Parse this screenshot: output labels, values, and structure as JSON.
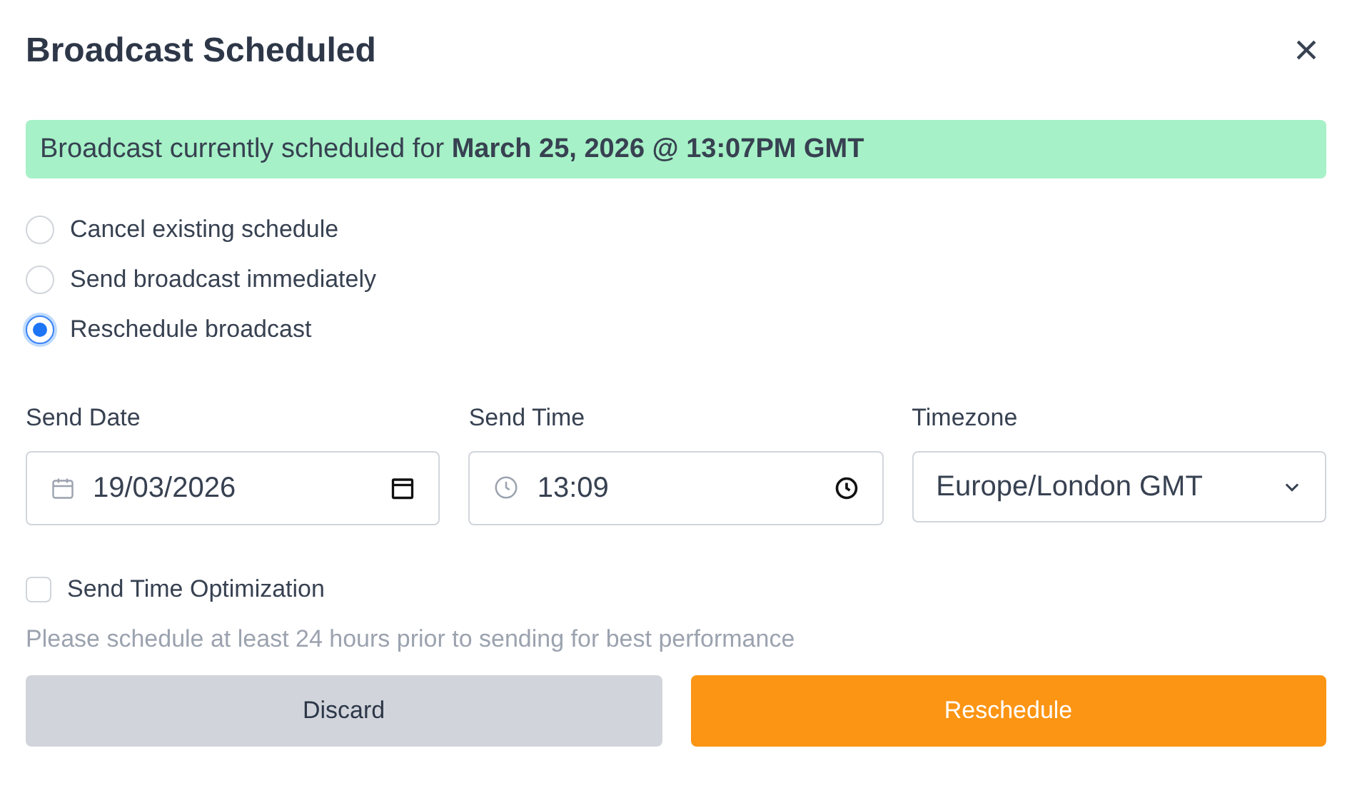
{
  "dialog": {
    "title": "Broadcast Scheduled",
    "close": "×"
  },
  "banner": "Broadcast currently scheduled for **March 25, 2026 @ 13:07PM GMT**",
  "options": [
    {
      "label": "Cancel existing schedule",
      "selected": false
    },
    {
      "label": "Send broadcast immediately",
      "selected": false
    },
    {
      "label": "Reschedule broadcast",
      "selected": true
    }
  ],
  "fields": [
    {
      "kind": "date",
      "label": "Send Date",
      "value": "19/03/2026"
    },
    {
      "kind": "time",
      "label": "Send Time",
      "value": "13:09"
    },
    {
      "kind": "select",
      "label": "Timezone",
      "value": "Europe/London GMT"
    }
  ],
  "send_time_optimization": {
    "label": "Send Time Optimization",
    "checked": false
  },
  "hint": "Please schedule at least 24 hours prior to sending for best performance",
  "buttons": [
    {
      "label": "Discard",
      "kind": "secondary"
    },
    {
      "label": "Reschedule",
      "kind": "primary"
    }
  ]
}
